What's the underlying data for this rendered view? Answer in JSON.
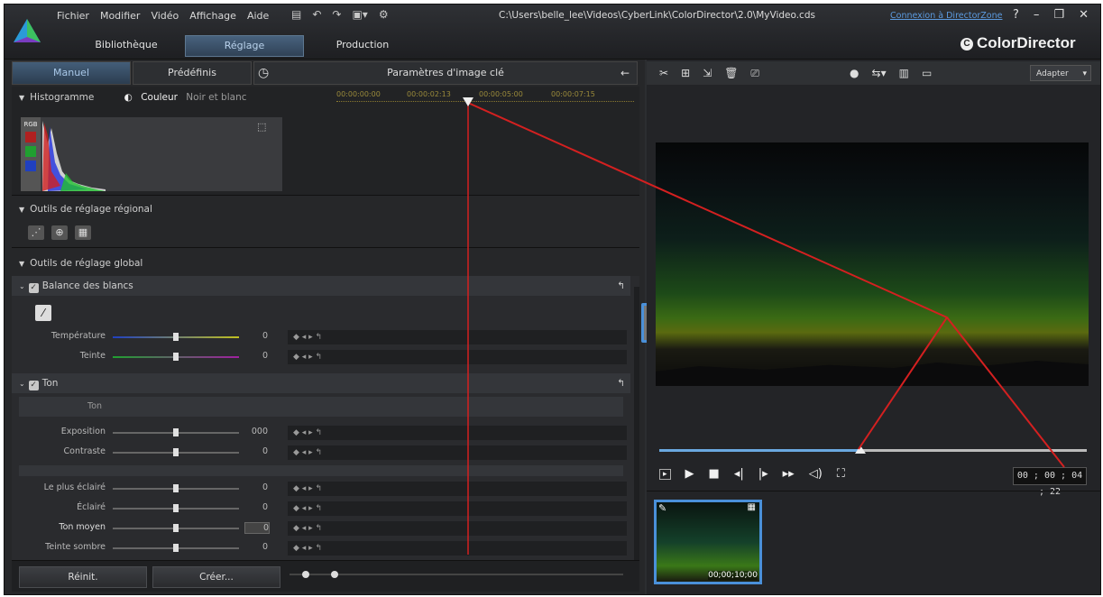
{
  "titlebar": {
    "menu": [
      "Fichier",
      "Modifier",
      "Vidéo",
      "Affichage",
      "Aide"
    ],
    "path": "C:\\Users\\belle_lee\\Videos\\CyberLink\\ColorDirector\\2.0\\MyVideo.cds",
    "connection_link": "Connexion à DirectorZone",
    "help": "?",
    "brand": "ColorDirector",
    "brand_mark": "C",
    "main_tabs": [
      "Bibliothèque",
      "Réglage",
      "Production"
    ]
  },
  "left": {
    "tabs": [
      "Manuel",
      "Prédéfinis"
    ],
    "keyframe_title": "Paramètres d'image clé",
    "histogram": {
      "title": "Histogramme",
      "mode_color": "Couleur",
      "mode_bw": "Noir et blanc",
      "rgb_label": "RGB"
    },
    "timeline_marks": [
      "00:00:00:00",
      "00:00:02:13",
      "00:00:05:00",
      "00:00:07:15"
    ],
    "regional_title": "Outils de réglage régional",
    "global_title": "Outils de réglage global",
    "white_balance": {
      "title": "Balance des blancs",
      "rows": [
        {
          "label": "Température",
          "value": "0",
          "pos": 50
        },
        {
          "label": "Teinte",
          "value": "0",
          "pos": 50
        }
      ]
    },
    "tone": {
      "title": "Ton",
      "sub": "Ton",
      "rows_a": [
        {
          "label": "Exposition",
          "value": "000",
          "pos": 50
        },
        {
          "label": "Contraste",
          "value": "0",
          "pos": 50
        }
      ],
      "rows_b": [
        {
          "label": "Le plus éclairé",
          "value": "0",
          "pos": 50
        },
        {
          "label": "Éclairé",
          "value": "0",
          "pos": 50
        },
        {
          "label": "Ton moyen",
          "value": "0",
          "pos": 50
        },
        {
          "label": "Teinte sombre",
          "value": "0",
          "pos": 50
        }
      ]
    },
    "buttons": {
      "reset": "Réinit.",
      "create": "Créer..."
    }
  },
  "right": {
    "fit_label": "Adapter",
    "timecode": "00 ; 00 ; 04 ; 22",
    "progress": 0.47,
    "thumb_timecode": "00;00;10;00"
  },
  "colors": {
    "accent": "#4a90d9",
    "annotation": "#d42020"
  }
}
